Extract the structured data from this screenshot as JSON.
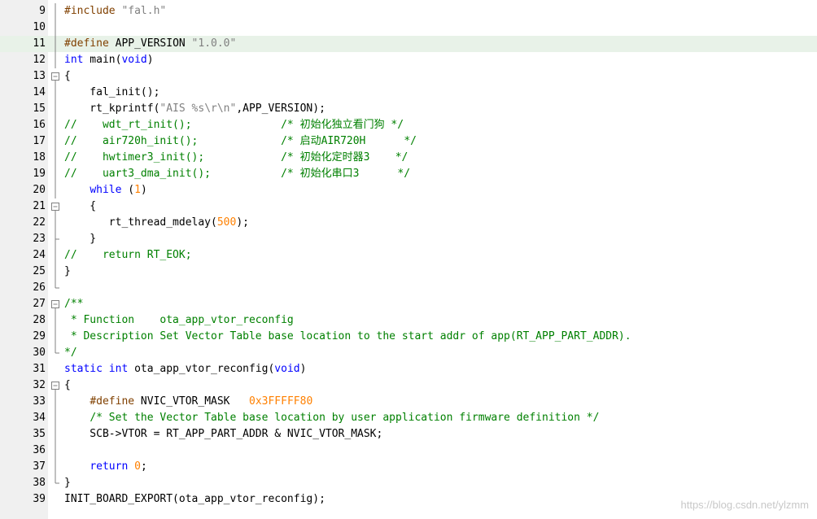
{
  "colors": {
    "keyword": "#0000ff",
    "preprocessor": "#804000",
    "string": "#808080",
    "number": "#ff8000",
    "comment": "#008000",
    "gutter": "#f0f0f0",
    "current_line": "#e8f2e8"
  },
  "watermark": "https://blog.csdn.net/ylzmm",
  "lines": [
    {
      "n": "9",
      "fold": "bar",
      "tokens": [
        {
          "t": "pp",
          "v": "#include "
        },
        {
          "t": "str",
          "v": "\"fal.h\""
        }
      ]
    },
    {
      "n": "10",
      "fold": "bar",
      "tokens": []
    },
    {
      "n": "11",
      "fold": "bar",
      "hl": true,
      "tokens": [
        {
          "t": "pp",
          "v": "#define"
        },
        {
          "t": "",
          "v": " APP_VERSION "
        },
        {
          "t": "str",
          "v": "\"1.0.0\""
        }
      ]
    },
    {
      "n": "12",
      "fold": "bar",
      "tokens": [
        {
          "t": "kw",
          "v": "int"
        },
        {
          "t": "",
          "v": " main("
        },
        {
          "t": "kw",
          "v": "void"
        },
        {
          "t": "",
          "v": ")"
        }
      ]
    },
    {
      "n": "13",
      "fold": "open",
      "tokens": [
        {
          "t": "",
          "v": "{"
        }
      ]
    },
    {
      "n": "14",
      "fold": "bar",
      "tokens": [
        {
          "t": "",
          "v": "    fal_init();"
        }
      ]
    },
    {
      "n": "15",
      "fold": "bar",
      "tokens": [
        {
          "t": "",
          "v": "    rt_kprintf("
        },
        {
          "t": "str",
          "v": "\"AIS %s\\r\\n\""
        },
        {
          "t": "",
          "v": ",APP_VERSION);"
        }
      ]
    },
    {
      "n": "16",
      "fold": "bar",
      "tokens": [
        {
          "t": "cm",
          "v": "//    wdt_rt_init();              /* 初始化独立看门狗 */"
        }
      ]
    },
    {
      "n": "17",
      "fold": "bar",
      "tokens": [
        {
          "t": "cm",
          "v": "//    air720h_init();             /* 启动AIR720H      */"
        }
      ]
    },
    {
      "n": "18",
      "fold": "bar",
      "tokens": [
        {
          "t": "cm",
          "v": "//    hwtimer3_init();            /* 初始化定时器3    */"
        }
      ]
    },
    {
      "n": "19",
      "fold": "bar",
      "tokens": [
        {
          "t": "cm",
          "v": "//    uart3_dma_init();           /* 初始化串口3      */"
        }
      ]
    },
    {
      "n": "20",
      "fold": "bar",
      "tokens": [
        {
          "t": "",
          "v": "    "
        },
        {
          "t": "kw",
          "v": "while"
        },
        {
          "t": "",
          "v": " ("
        },
        {
          "t": "num",
          "v": "1"
        },
        {
          "t": "",
          "v": ")"
        }
      ]
    },
    {
      "n": "21",
      "fold": "open",
      "tokens": [
        {
          "t": "",
          "v": "    {"
        }
      ]
    },
    {
      "n": "22",
      "fold": "bar",
      "tokens": [
        {
          "t": "",
          "v": "       rt_thread_mdelay("
        },
        {
          "t": "num",
          "v": "500"
        },
        {
          "t": "",
          "v": ");"
        }
      ]
    },
    {
      "n": "23",
      "fold": "tick",
      "tokens": [
        {
          "t": "",
          "v": "    }"
        }
      ]
    },
    {
      "n": "24",
      "fold": "bar",
      "tokens": [
        {
          "t": "cm",
          "v": "//    return RT_EOK;"
        }
      ]
    },
    {
      "n": "25",
      "fold": "bar",
      "tokens": [
        {
          "t": "",
          "v": "}"
        }
      ]
    },
    {
      "n": "26",
      "fold": "end",
      "tokens": []
    },
    {
      "n": "27",
      "fold": "open",
      "tokens": [
        {
          "t": "cm",
          "v": "/**"
        }
      ]
    },
    {
      "n": "28",
      "fold": "bar",
      "tokens": [
        {
          "t": "cm",
          "v": " * Function    ota_app_vtor_reconfig"
        }
      ]
    },
    {
      "n": "29",
      "fold": "bar",
      "tokens": [
        {
          "t": "cm",
          "v": " * Description Set Vector Table base location to the start addr of app(RT_APP_PART_ADDR)."
        }
      ]
    },
    {
      "n": "30",
      "fold": "end",
      "tokens": [
        {
          "t": "cm",
          "v": "*/"
        }
      ]
    },
    {
      "n": "31",
      "fold": "none",
      "tokens": [
        {
          "t": "kw",
          "v": "static"
        },
        {
          "t": "",
          "v": " "
        },
        {
          "t": "kw",
          "v": "int"
        },
        {
          "t": "",
          "v": " ota_app_vtor_reconfig("
        },
        {
          "t": "kw",
          "v": "void"
        },
        {
          "t": "",
          "v": ")"
        }
      ]
    },
    {
      "n": "32",
      "fold": "open",
      "tokens": [
        {
          "t": "",
          "v": "{"
        }
      ]
    },
    {
      "n": "33",
      "fold": "bar",
      "tokens": [
        {
          "t": "",
          "v": "    "
        },
        {
          "t": "pp",
          "v": "#define"
        },
        {
          "t": "",
          "v": " NVIC_VTOR_MASK   "
        },
        {
          "t": "num",
          "v": "0x3FFFFF80"
        }
      ]
    },
    {
      "n": "34",
      "fold": "bar",
      "tokens": [
        {
          "t": "",
          "v": "    "
        },
        {
          "t": "cm",
          "v": "/* Set the Vector Table base location by user application firmware definition */"
        }
      ]
    },
    {
      "n": "35",
      "fold": "bar",
      "tokens": [
        {
          "t": "",
          "v": "    SCB->VTOR = RT_APP_PART_ADDR & NVIC_VTOR_MASK;"
        }
      ]
    },
    {
      "n": "36",
      "fold": "bar",
      "tokens": []
    },
    {
      "n": "37",
      "fold": "bar",
      "tokens": [
        {
          "t": "",
          "v": "    "
        },
        {
          "t": "kw",
          "v": "return"
        },
        {
          "t": "",
          "v": " "
        },
        {
          "t": "num",
          "v": "0"
        },
        {
          "t": "",
          "v": ";"
        }
      ]
    },
    {
      "n": "38",
      "fold": "end",
      "tokens": [
        {
          "t": "",
          "v": "}"
        }
      ]
    },
    {
      "n": "39",
      "fold": "none",
      "tokens": [
        {
          "t": "",
          "v": "INIT_BOARD_EXPORT(ota_app_vtor_reconfig);"
        }
      ]
    }
  ]
}
